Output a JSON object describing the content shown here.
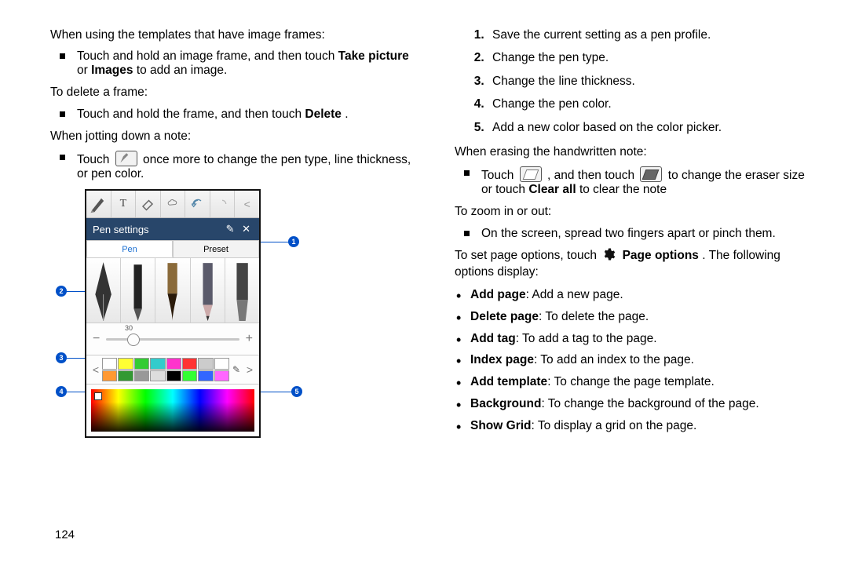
{
  "page_number": "124",
  "left": {
    "p_templates": "When using the templates that have image frames:",
    "b_templates_1a": "Touch and hold an image frame, and then touch ",
    "b_templates_bold1": "Take picture",
    "b_templates_mid": " or ",
    "b_templates_bold2": "Images",
    "b_templates_1b": " to add an image.",
    "p_delete": "To delete a frame:",
    "b_delete_1a": "Touch and hold the frame, and then touch ",
    "b_delete_bold": "Delete",
    "b_delete_1b": ".",
    "p_jot": "When jotting down a note:",
    "b_jot_1a": "Touch ",
    "b_jot_1b": " once more to change the pen type, line thickness, or pen color.",
    "figure": {
      "pen_settings_label": "Pen settings",
      "tab_pen": "Pen",
      "tab_preset": "Preset",
      "thickness_value": "30",
      "swatches": [
        "#ffffff",
        "#ffff33",
        "#33cc33",
        "#33cccc",
        "#ff33cc",
        "#ff3333",
        "#cccccc",
        "#ffffff",
        "#ff9933",
        "#339933",
        "#999999",
        "#dddddd",
        "#000000",
        "#33ff33",
        "#3366ff",
        "#ff66ff"
      ],
      "callouts": {
        "c1": "1",
        "c2": "2",
        "c3": "3",
        "c4": "4",
        "c5": "5"
      }
    }
  },
  "right": {
    "ol": [
      "Save the current setting as a pen profile.",
      "Change the pen type.",
      "Change the line thickness.",
      "Change the pen color.",
      "Add a new color based on the color picker."
    ],
    "p_erase": "When erasing the handwritten note:",
    "b_erase_1a": "Touch ",
    "b_erase_1b": ", and then touch ",
    "b_erase_1c": " to change the eraser size or touch ",
    "b_erase_bold": "Clear all",
    "b_erase_1d": " to clear the note",
    "p_zoom": "To zoom in or out:",
    "b_zoom_1": "On the screen, spread two fingers apart or pinch them.",
    "p_pageopt_a": "To set page options, touch ",
    "p_pageopt_bold": "Page options",
    "p_pageopt_b": ". The following options display:",
    "opts": [
      {
        "b": "Add page",
        "t": ": Add a new page."
      },
      {
        "b": "Delete page",
        "t": ": To delete the page."
      },
      {
        "b": "Add tag",
        "t": ": To add a tag to the page."
      },
      {
        "b": "Index page",
        "t": ": To add an index to the page."
      },
      {
        "b": "Add template",
        "t": ": To change the page template."
      },
      {
        "b": "Background",
        "t": ": To change the background of the page."
      },
      {
        "b": "Show Grid",
        "t": ": To display a grid on the page."
      }
    ]
  }
}
